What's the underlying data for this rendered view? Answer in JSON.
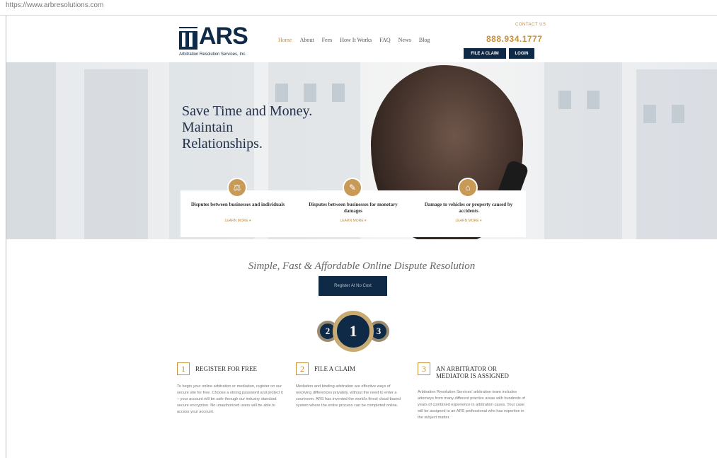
{
  "browser": {
    "url": "https://www.arbresolutions.com"
  },
  "header": {
    "logo_text": "ARS",
    "logo_sub": "Arbitration Resolution Services, Inc.",
    "nav": [
      "Home",
      "About",
      "Fees",
      "How It Works",
      "FAQ",
      "News",
      "Blog"
    ],
    "contact_label": "CONTACT US",
    "phone": "888.934.1777",
    "file_claim": "FILE A CLAIM",
    "login": "LOGIN"
  },
  "hero": {
    "title_line1": "Save Time and Money.",
    "title_line2": "Maintain",
    "title_line3": "Relationships.",
    "cards": [
      {
        "icon": "scale-icon",
        "title": "Disputes between businesses and individuals",
        "more": "LEARN MORE"
      },
      {
        "icon": "tag-icon",
        "title": "Disputes between businesses for monetary damages",
        "more": "LEARN MORE"
      },
      {
        "icon": "home-icon",
        "title": "Damage to vehicles or property caused by accidents",
        "more": "LEARN MORE"
      }
    ]
  },
  "main": {
    "tagline": "Simple, Fast & Affordable Online Dispute Resolution",
    "register_button": "Register At No Cost",
    "medals": [
      "2",
      "1",
      "3"
    ],
    "steps": [
      {
        "num": "1",
        "title": "REGISTER FOR FREE",
        "text": "To begin your online arbitration or mediation, register on our secure site for free. Choose a strong password and protect it – your account will be safe through our industry standard secure encryption. No unauthorized users will be able to access your account."
      },
      {
        "num": "2",
        "title": "FILE A CLAIM",
        "text": "Mediation and binding arbitration are effective ways of resolving differences privately, without the need to enter a courtroom. ARS has invented the world's finest cloud-based system where the entire process can be completed online."
      },
      {
        "num": "3",
        "title": "AN ARBITRATOR OR MEDIATOR IS ASSIGNED",
        "text": "Arbitration Resolution Services' arbitration team includes attorneys from many different practice areas with hundreds of years of combined experience in arbitration cases. Your case will be assigned to an ARS professional who has expertise in the subject matter."
      }
    ]
  },
  "colors": {
    "navy": "#0e2a47",
    "gold": "#c58f3a"
  }
}
